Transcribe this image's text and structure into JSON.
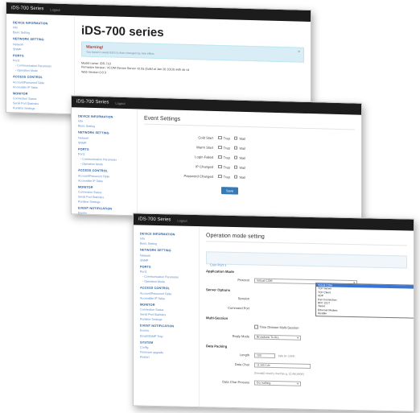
{
  "brand": "iDS-700 Series",
  "logout": "Logout",
  "sidebar": [
    {
      "type": "sec",
      "label": "DEVICE INFORMATION"
    },
    {
      "type": "item",
      "label": "Info"
    },
    {
      "type": "item",
      "label": "Basic Setting"
    },
    {
      "type": "sec",
      "label": "NETWORK SETTING"
    },
    {
      "type": "item",
      "label": "Network"
    },
    {
      "type": "item",
      "label": "SNMP"
    },
    {
      "type": "sec",
      "label": "PORTS"
    },
    {
      "type": "item",
      "label": "Port1"
    },
    {
      "type": "sub",
      "label": "- Communication Parameter"
    },
    {
      "type": "sub",
      "label": "- Operation Mode"
    },
    {
      "type": "sec",
      "label": "ACCESS CONTROL"
    },
    {
      "type": "item",
      "label": "Account/Password Table"
    },
    {
      "type": "item",
      "label": "Accessible IP Table"
    },
    {
      "type": "sec",
      "label": "MONITOR"
    },
    {
      "type": "item",
      "label": "Connection Status"
    },
    {
      "type": "item",
      "label": "Serial Port Statistics"
    },
    {
      "type": "item",
      "label": "Runtime Settings"
    },
    {
      "type": "sec",
      "label": "EVENT NOTIFICATION"
    },
    {
      "type": "item",
      "label": "Events"
    },
    {
      "type": "item",
      "label": "Email/SNMP Trap"
    },
    {
      "type": "sec",
      "label": "SYSTEM"
    },
    {
      "type": "item",
      "label": "Config"
    },
    {
      "type": "item",
      "label": "Firmware upgrade"
    },
    {
      "type": "item",
      "label": "Restart"
    }
  ],
  "overview": {
    "title": "iDS-700 series",
    "warning_title": "Warning!",
    "warning_text": "You haven't saved EDS to Auto changed by new effect.",
    "info": [
      "Model name: iDS-710",
      "Firmware Version: VCOM Device Server v0.0a (build at Jan 20 2010) with nb v4",
      "Web Version 0.0.3"
    ]
  },
  "events": {
    "title": "Event Settings",
    "rows": [
      {
        "label": "Cold Start",
        "opt1": "Trap",
        "opt2": "Mail"
      },
      {
        "label": "Warm Start",
        "opt1": "Trap",
        "opt2": "Mail"
      },
      {
        "label": "Login Failed",
        "opt1": "Trap",
        "opt2": "Mail"
      },
      {
        "label": "IP Changed",
        "opt1": "Trap",
        "opt2": "Mail"
      },
      {
        "label": "Password Changed",
        "opt1": "Trap",
        "opt2": "Mail"
      }
    ],
    "save": "Save"
  },
  "opmode": {
    "title": "Operation mode setting",
    "tab": "Com Port 1",
    "app_mode_heading": "Application Mode",
    "protocol_label": "Protocol",
    "protocol_value": "Virtual COM",
    "server_options": "Server Options",
    "session_label": "Session",
    "command_port_label": "Command Port",
    "multi_session": "Multi-Session",
    "time_division": "Time Division Multi-Session",
    "reply_mode_label": "Reply Mode",
    "reply_mode_value": "Broadcast To ALL",
    "data_packing": "Data Packing",
    "length_label": "Length",
    "length_value": "100",
    "length_hint": "byte (0~1024)",
    "delimiter_label": "Data Char",
    "delimiter_value": "11:bf0:1de",
    "delimiter_hint": "(format(0-char)*(,char)*)(e.g. 12,AB,5A0E)",
    "char_process_label": "Data Char Process",
    "char_process_value": "Do nothing",
    "protocol_options": [
      "Virtual COM",
      "TCP Server",
      "TCP Client",
      "UDP",
      "Pair Connection",
      "RFC 2217",
      "Telnet",
      "Ethernet Modem",
      "Disable"
    ]
  }
}
